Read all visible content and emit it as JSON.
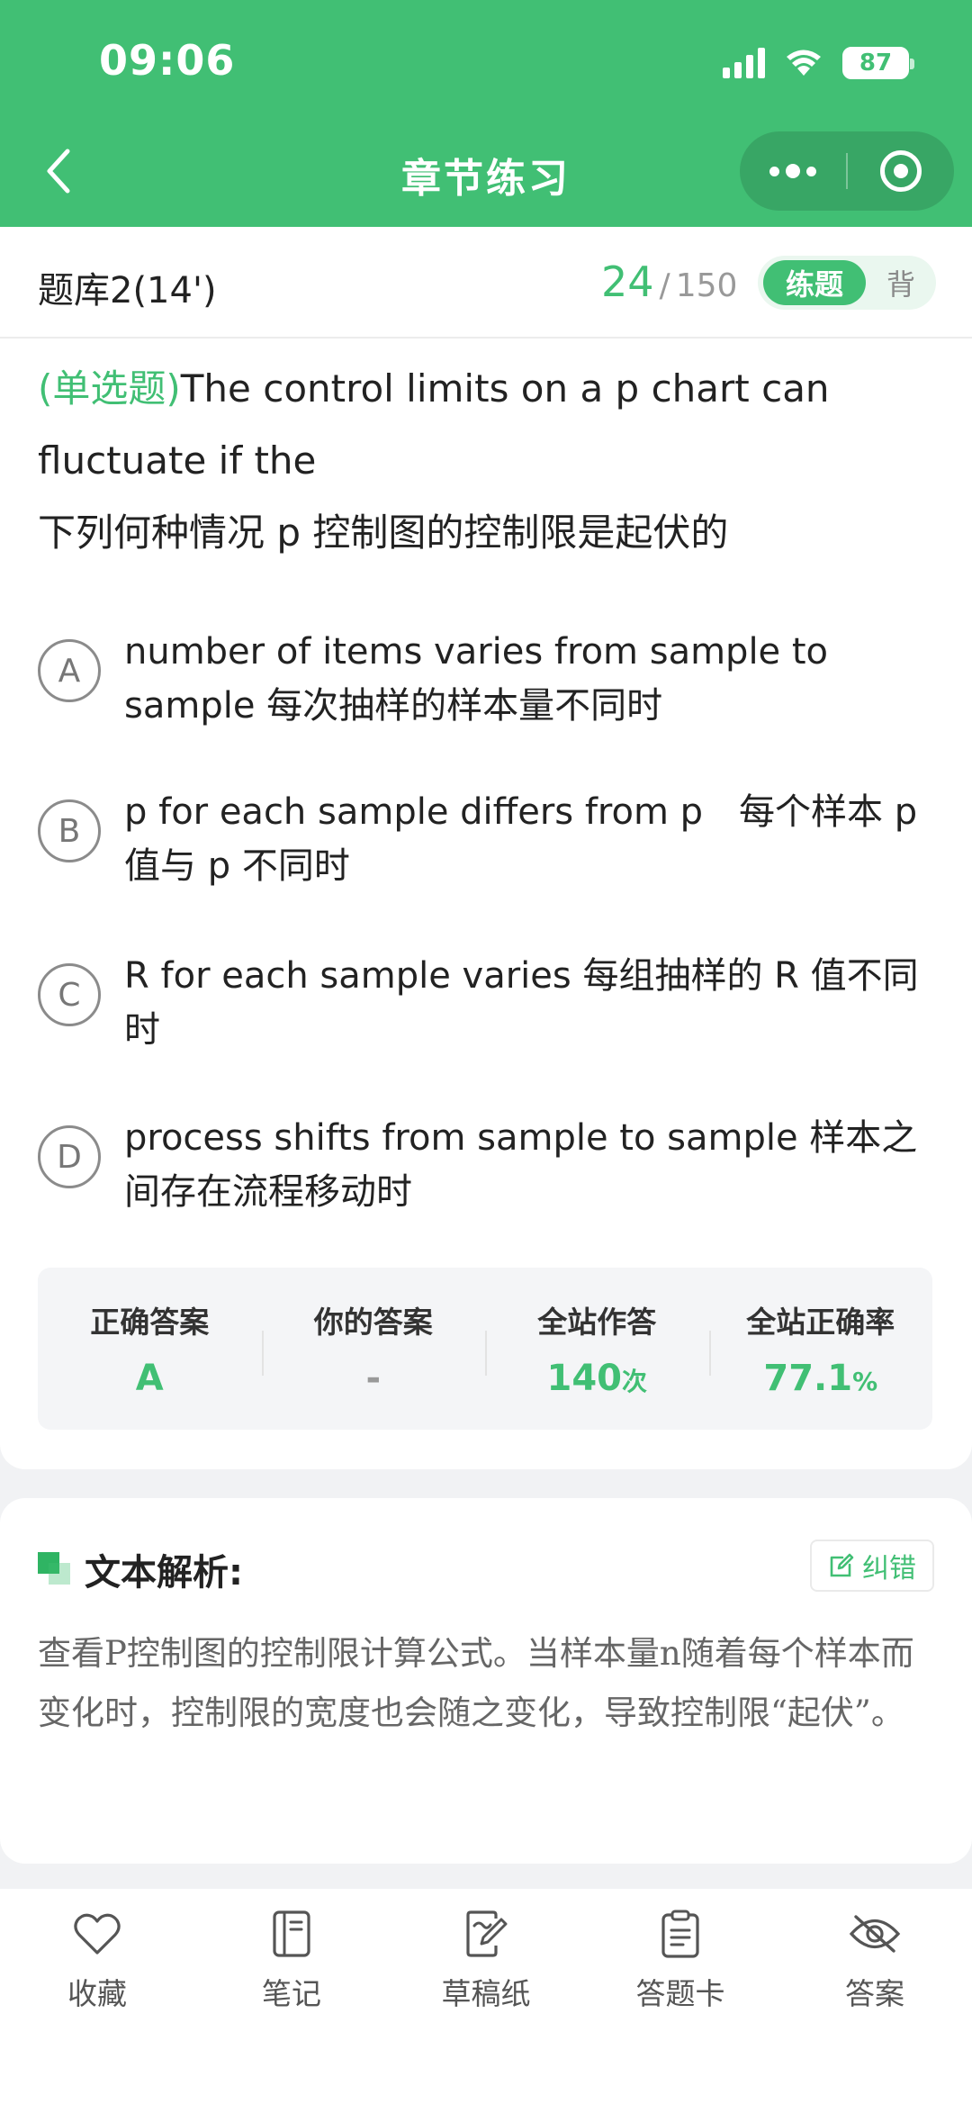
{
  "status": {
    "time": "09:06",
    "battery": "87"
  },
  "nav": {
    "title": "章节练习"
  },
  "subhead": {
    "bank_title": "题库2(14')",
    "progress_current": "24",
    "progress_sep": "/",
    "progress_total": "150",
    "mode_active": "练题",
    "mode_inactive": "背"
  },
  "question": {
    "type_label": "(单选题)",
    "text_en": "The control limits on a p chart can fluctuate if the",
    "text_zh": "下列何种情况 p 控制图的控制限是起伏的"
  },
  "options": [
    {
      "letter": "A",
      "text": "number of items varies from sample to sample 每次抽样的样本量不同时"
    },
    {
      "letter": "B",
      "text": "p for each sample differs from p　每个样本 p 值与 p 不同时"
    },
    {
      "letter": "C",
      "text": "R for each sample varies 每组抽样的 R 值不同时"
    },
    {
      "letter": "D",
      "text": "process shifts from sample to sample 样本之间存在流程移动时"
    }
  ],
  "stats": {
    "correct_label": "正确答案",
    "correct_value": "A",
    "yours_label": "你的答案",
    "yours_value": "-",
    "total_label": "全站作答",
    "total_value": "140",
    "total_unit": "次",
    "rate_label": "全站正确率",
    "rate_value": "77.1",
    "rate_unit": "%"
  },
  "analysis": {
    "title": "文本解析:",
    "correction": "纠错",
    "body": "查看P控制图的控制限计算公式。当样本量n随着每个样本而变化时，控制限的宽度也会随之变化，导致控制限“起伏”。"
  },
  "tabs": [
    {
      "label": "收藏",
      "icon": "heart-icon"
    },
    {
      "label": "笔记",
      "icon": "notebook-icon"
    },
    {
      "label": "草稿纸",
      "icon": "draft-paper-icon"
    },
    {
      "label": "答题卡",
      "icon": "answer-sheet-icon"
    },
    {
      "label": "答案",
      "icon": "eye-off-icon"
    }
  ],
  "colors": {
    "primary": "#41bf74",
    "background": "#f1f2f4"
  }
}
